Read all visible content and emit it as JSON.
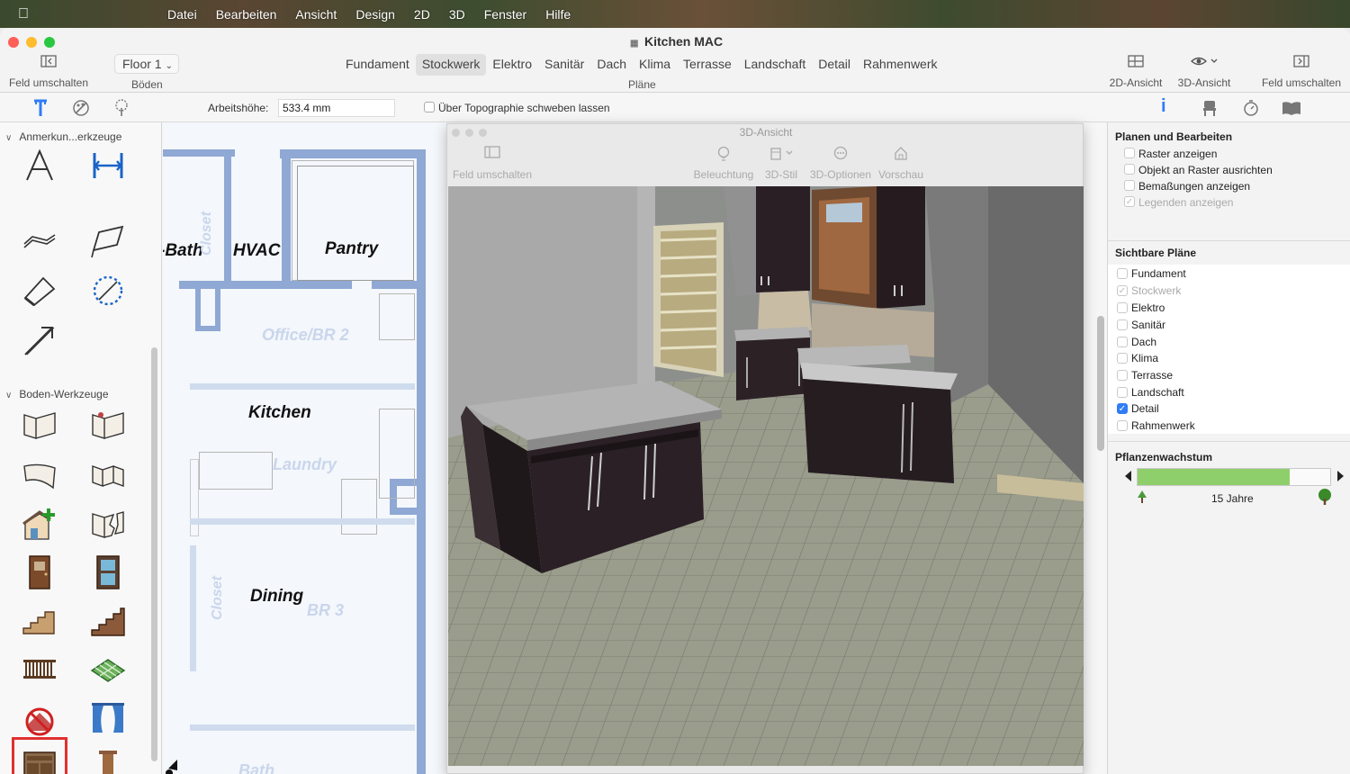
{
  "menubar": {
    "items": [
      "Datei",
      "Bearbeiten",
      "Ansicht",
      "Design",
      "2D",
      "3D",
      "Fenster",
      "Hilfe"
    ]
  },
  "window": {
    "title": "Kitchen MAC"
  },
  "toolbar": {
    "left_toggle_label": "Feld umschalten",
    "floor_select_value": "Floor 1",
    "floors_label": "Böden",
    "plans": [
      "Fundament",
      "Stockwerk",
      "Elektro",
      "Sanitär",
      "Dach",
      "Klima",
      "Terrasse",
      "Landschaft",
      "Detail",
      "Rahmenwerk"
    ],
    "active_plan": "Stockwerk",
    "plans_label": "Pläne",
    "view2d_label": "2D-Ansicht",
    "view3d_label": "3D-Ansicht",
    "right_toggle_label": "Feld umschalten"
  },
  "tool_options": {
    "work_height_label": "Arbeitshöhe:",
    "work_height_value": "533.4 mm",
    "float_label": "Über Topographie schweben lassen"
  },
  "left_panel": {
    "section1": "Anmerkun...erkzeuge",
    "section2": "Boden-Werkzeuge"
  },
  "floorplan": {
    "rooms": [
      "-Bath",
      "HVAC",
      "Pantry",
      "Kitchen",
      "Dining"
    ],
    "ghost_rooms": [
      "Office/BR 2",
      "Laundry",
      "BR 3",
      "Closet",
      "Closet",
      "Bath"
    ]
  },
  "view3d": {
    "title": "3D-Ansicht",
    "tools": [
      "Feld umschalten",
      "Beleuchtung",
      "3D-Stil",
      "3D-Optionen",
      "Vorschau"
    ]
  },
  "right_panel": {
    "section_edit": "Planen und Bearbeiten",
    "edit_options": [
      {
        "label": "Raster anzeigen",
        "checked": false,
        "disabled": false
      },
      {
        "label": "Objekt an Raster ausrichten",
        "checked": false,
        "disabled": false
      },
      {
        "label": "Bemaßungen anzeigen",
        "checked": false,
        "disabled": false
      },
      {
        "label": "Legenden anzeigen",
        "checked": true,
        "disabled": true
      }
    ],
    "section_visible": "Sichtbare Pläne",
    "visible_plans": [
      {
        "label": "Fundament",
        "checked": false,
        "disabled": false
      },
      {
        "label": "Stockwerk",
        "checked": true,
        "disabled": true
      },
      {
        "label": "Elektro",
        "checked": false,
        "disabled": false
      },
      {
        "label": "Sanitär",
        "checked": false,
        "disabled": false
      },
      {
        "label": "Dach",
        "checked": false,
        "disabled": false
      },
      {
        "label": "Klima",
        "checked": false,
        "disabled": false
      },
      {
        "label": "Terrasse",
        "checked": false,
        "disabled": false
      },
      {
        "label": "Landschaft",
        "checked": false,
        "disabled": false
      },
      {
        "label": "Detail",
        "checked": true,
        "disabled": false
      },
      {
        "label": "Rahmenwerk",
        "checked": false,
        "disabled": false
      }
    ],
    "section_growth": "Pflanzenwachstum",
    "growth_fraction": 0.79,
    "growth_label": "15 Jahre"
  },
  "colors": {
    "accent": "#2f7cf6",
    "wall": "#8fa8d4",
    "growth": "#8fcf6b",
    "selection": "#e03030"
  }
}
